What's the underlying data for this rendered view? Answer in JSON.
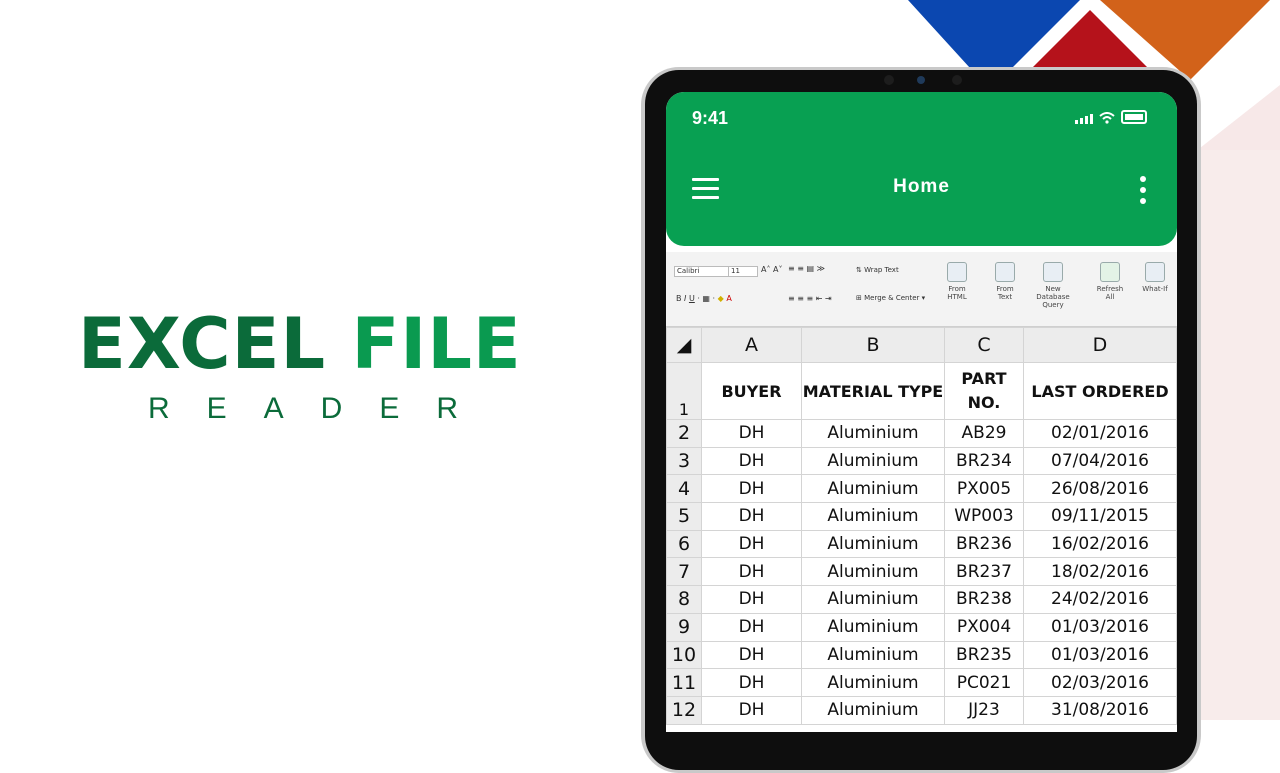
{
  "hero": {
    "title_word1": "EXCEL",
    "title_word2": "FILE",
    "subtitle": "READER"
  },
  "status_bar": {
    "time": "9:41"
  },
  "app_bar": {
    "title": "Home"
  },
  "ribbon": {
    "font_name": "Calibri",
    "font_size": "11",
    "wrap_text": "Wrap Text",
    "merge_center": "Merge & Center",
    "tools": [
      {
        "label_line1": "From",
        "label_line2": "HTML"
      },
      {
        "label_line1": "From",
        "label_line2": "Text"
      },
      {
        "label_line1": "New Database",
        "label_line2": "Query"
      },
      {
        "label_line1": "Refresh",
        "label_line2": "All"
      },
      {
        "label_line1": "What-If",
        "label_line2": ""
      }
    ]
  },
  "sheet": {
    "columns": [
      "A",
      "B",
      "C",
      "D"
    ],
    "header_row": {
      "num": "1",
      "cells": [
        "BUYER",
        "MATERIAL TYPE",
        "PART NO.",
        "LAST ORDERED"
      ]
    },
    "rows": [
      {
        "num": "2",
        "cells": [
          "DH",
          "Aluminium",
          "AB29",
          "02/01/2016"
        ]
      },
      {
        "num": "3",
        "cells": [
          "DH",
          "Aluminium",
          "BR234",
          "07/04/2016"
        ]
      },
      {
        "num": "4",
        "cells": [
          "DH",
          "Aluminium",
          "PX005",
          "26/08/2016"
        ]
      },
      {
        "num": "5",
        "cells": [
          "DH",
          "Aluminium",
          "WP003",
          "09/11/2015"
        ]
      },
      {
        "num": "6",
        "cells": [
          "DH",
          "Aluminium",
          "BR236",
          "16/02/2016"
        ]
      },
      {
        "num": "7",
        "cells": [
          "DH",
          "Aluminium",
          "BR237",
          "18/02/2016"
        ]
      },
      {
        "num": "8",
        "cells": [
          "DH",
          "Aluminium",
          "BR238",
          "24/02/2016"
        ]
      },
      {
        "num": "9",
        "cells": [
          "DH",
          "Aluminium",
          "PX004",
          "01/03/2016"
        ]
      },
      {
        "num": "10",
        "cells": [
          "DH",
          "Aluminium",
          "BR235",
          "01/03/2016"
        ]
      },
      {
        "num": "11",
        "cells": [
          "DH",
          "Aluminium",
          "PC021",
          "02/03/2016"
        ]
      },
      {
        "num": "12",
        "cells": [
          "DH",
          "Aluminium",
          "JJ23",
          "31/08/2016"
        ]
      }
    ]
  },
  "colors": {
    "brand_green": "#08a052",
    "title_dark_green": "#0b6b3a",
    "deco_blue": "#0b47b0",
    "deco_red": "#b5121b",
    "deco_orange": "#d2621a"
  }
}
